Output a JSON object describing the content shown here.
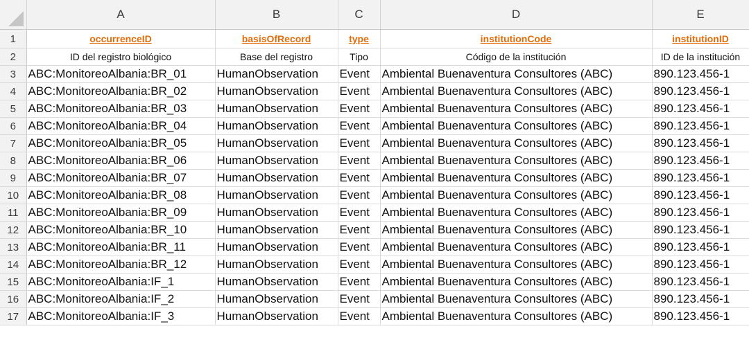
{
  "colors": {
    "field_header_color": "#E36C09",
    "header_bg": "#f2f2f2"
  },
  "columns": [
    "A",
    "B",
    "C",
    "D",
    "E"
  ],
  "field_row": {
    "row_number": "1",
    "cells": [
      "occurrenceID",
      "basisOfRecord",
      "type",
      "institutionCode",
      "institutionID"
    ]
  },
  "desc_row": {
    "row_number": "2",
    "cells": [
      "ID del registro biológico",
      "Base del registro",
      "Tipo",
      "Código de la institución",
      "ID de la institución"
    ]
  },
  "rows": [
    {
      "num": "3",
      "cells": [
        "ABC:MonitoreoAlbania:BR_01",
        "HumanObservation",
        "Event",
        "Ambiental Buenaventura Consultores (ABC)",
        "890.123.456-1"
      ]
    },
    {
      "num": "4",
      "cells": [
        "ABC:MonitoreoAlbania:BR_02",
        "HumanObservation",
        "Event",
        "Ambiental Buenaventura Consultores (ABC)",
        "890.123.456-1"
      ]
    },
    {
      "num": "5",
      "cells": [
        "ABC:MonitoreoAlbania:BR_03",
        "HumanObservation",
        "Event",
        "Ambiental Buenaventura Consultores (ABC)",
        "890.123.456-1"
      ]
    },
    {
      "num": "6",
      "cells": [
        "ABC:MonitoreoAlbania:BR_04",
        "HumanObservation",
        "Event",
        "Ambiental Buenaventura Consultores (ABC)",
        "890.123.456-1"
      ]
    },
    {
      "num": "7",
      "cells": [
        "ABC:MonitoreoAlbania:BR_05",
        "HumanObservation",
        "Event",
        "Ambiental Buenaventura Consultores (ABC)",
        "890.123.456-1"
      ]
    },
    {
      "num": "8",
      "cells": [
        "ABC:MonitoreoAlbania:BR_06",
        "HumanObservation",
        "Event",
        "Ambiental Buenaventura Consultores (ABC)",
        "890.123.456-1"
      ]
    },
    {
      "num": "9",
      "cells": [
        "ABC:MonitoreoAlbania:BR_07",
        "HumanObservation",
        "Event",
        "Ambiental Buenaventura Consultores (ABC)",
        "890.123.456-1"
      ]
    },
    {
      "num": "10",
      "cells": [
        "ABC:MonitoreoAlbania:BR_08",
        "HumanObservation",
        "Event",
        "Ambiental Buenaventura Consultores (ABC)",
        "890.123.456-1"
      ]
    },
    {
      "num": "11",
      "cells": [
        "ABC:MonitoreoAlbania:BR_09",
        "HumanObservation",
        "Event",
        "Ambiental Buenaventura Consultores (ABC)",
        "890.123.456-1"
      ]
    },
    {
      "num": "12",
      "cells": [
        "ABC:MonitoreoAlbania:BR_10",
        "HumanObservation",
        "Event",
        "Ambiental Buenaventura Consultores (ABC)",
        "890.123.456-1"
      ]
    },
    {
      "num": "13",
      "cells": [
        "ABC:MonitoreoAlbania:BR_11",
        "HumanObservation",
        "Event",
        "Ambiental Buenaventura Consultores (ABC)",
        "890.123.456-1"
      ]
    },
    {
      "num": "14",
      "cells": [
        "ABC:MonitoreoAlbania:BR_12",
        "HumanObservation",
        "Event",
        "Ambiental Buenaventura Consultores (ABC)",
        "890.123.456-1"
      ]
    },
    {
      "num": "15",
      "cells": [
        "ABC:MonitoreoAlbania:IF_1",
        "HumanObservation",
        "Event",
        "Ambiental Buenaventura Consultores (ABC)",
        "890.123.456-1"
      ]
    },
    {
      "num": "16",
      "cells": [
        "ABC:MonitoreoAlbania:IF_2",
        "HumanObservation",
        "Event",
        "Ambiental Buenaventura Consultores (ABC)",
        "890.123.456-1"
      ]
    },
    {
      "num": "17",
      "cells": [
        "ABC:MonitoreoAlbania:IF_3",
        "HumanObservation",
        "Event",
        "Ambiental Buenaventura Consultores (ABC)",
        "890.123.456-1"
      ]
    }
  ]
}
